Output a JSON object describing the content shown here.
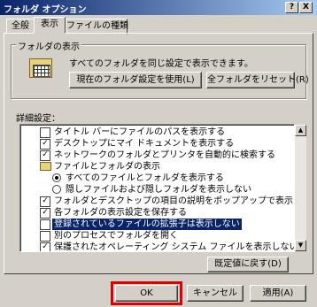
{
  "window": {
    "title": "フォルダ オプション",
    "help_label": "?",
    "close_label": "X"
  },
  "tabs": [
    {
      "label": "全般"
    },
    {
      "label": "表示"
    },
    {
      "label": "ファイルの種類"
    }
  ],
  "folder_view": {
    "group_label": "フォルダの表示",
    "description": "すべてのフォルダを同じ設定で表示できます。",
    "apply_button": "現在のフォルダ設定を使用(L)",
    "reset_button": "全フォルダをリセット(R)"
  },
  "advanced": {
    "label": "詳細設定：",
    "items": [
      {
        "type": "checkbox",
        "checked": false,
        "label": "タイトル バーにファイルのパスを表示する"
      },
      {
        "type": "checkbox",
        "checked": true,
        "label": "デスクトップにマイ ドキュメントを表示する"
      },
      {
        "type": "checkbox",
        "checked": true,
        "label": "ネットワークのフォルダとプリンタを自動的に検索する"
      },
      {
        "type": "folder",
        "label": "ファイルとフォルダの表示"
      },
      {
        "type": "radio",
        "checked": true,
        "label": "すべてのファイルとフォルダを表示する"
      },
      {
        "type": "radio",
        "checked": false,
        "label": "隠しファイルおよび隠しフォルダを表示しない"
      },
      {
        "type": "checkbox",
        "checked": true,
        "label": "フォルダとデスクトップの項目の説明をポップアップで表示する"
      },
      {
        "type": "checkbox",
        "checked": true,
        "label": "各フォルダの表示設定を保存する"
      },
      {
        "type": "checkbox",
        "checked": false,
        "label": "登録されているファイルの拡張子は表示しない",
        "selected": true
      },
      {
        "type": "checkbox",
        "checked": false,
        "label": "別のプロセスでフォルダを開く"
      },
      {
        "type": "checkbox",
        "checked": true,
        "label": "保護されたオペレーティング システム ファイルを表示しない (推奨)"
      }
    ],
    "restore_button": "既定値に戻す(D)"
  },
  "footer": {
    "ok": "OK",
    "cancel": "キャンセル",
    "apply": "適用(A)"
  },
  "check_glyph": "✓"
}
